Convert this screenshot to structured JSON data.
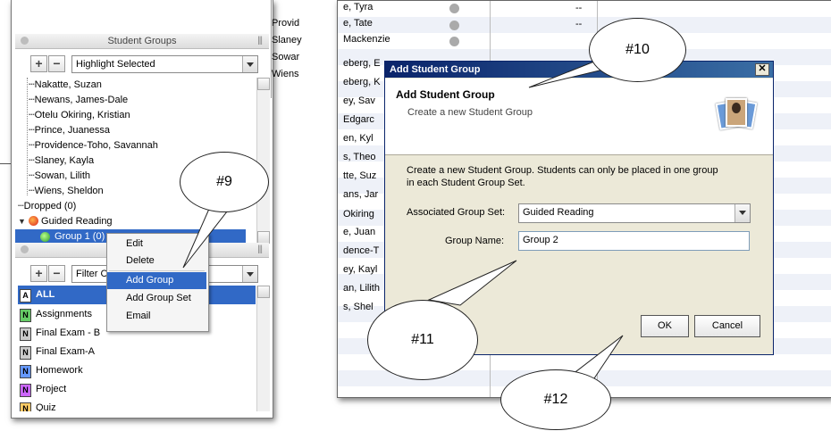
{
  "left_panel": {
    "middle_names": [
      "Provid",
      "Slaney",
      "Sowar",
      "Wiens"
    ],
    "student_groups_header": "Student Groups",
    "highlight_select": "Highlight Selected",
    "tree_items": [
      "Nakatte, Suzan",
      "Newans, James-Dale",
      "Otelu Okiring, Kristian",
      "Prince, Juanessa",
      "Providence-Toho, Savannah",
      "Slaney, Kayla",
      "Sowan, Lilith",
      "Wiens, Sheldon"
    ],
    "dropped": "Dropped (0)",
    "guided_reading": "Guided Reading",
    "group1": "Group 1 (0)",
    "filter_select": "Filter C",
    "categories": [
      {
        "icon": "A",
        "label": "ALL"
      },
      {
        "icon": "N",
        "label": "Assignments"
      },
      {
        "icon": "N",
        "label": "Final Exam - B"
      },
      {
        "icon": "N",
        "label": "Final Exam-A"
      },
      {
        "icon": "N",
        "label": "Homework"
      },
      {
        "icon": "N",
        "label": "Project"
      },
      {
        "icon": "N",
        "label": "Quiz"
      }
    ],
    "context_menu": [
      "Edit",
      "Delete",
      "Add Group",
      "Add Group Set",
      "Email"
    ]
  },
  "callouts": {
    "c9": "#9",
    "c10": "#10",
    "c11": "#11",
    "c12": "#12"
  },
  "right_panel": {
    "names": [
      "e, Tyra",
      "e, Tate",
      "Mackenzie",
      "eberg, E",
      "eberg, K",
      "ey, Sav",
      "Edgarc",
      "en, Kyl",
      "s, Theo",
      "tte, Suz",
      "ans, Jar",
      "Okiring",
      "e, Juan",
      "dence-T",
      "ey, Kayl",
      "an, Lilith",
      "s, Shel"
    ],
    "dashes": "--"
  },
  "dialog": {
    "title_bar": "Add Student Group",
    "heading": "Add Student Group",
    "subheading": "Create a new Student Group",
    "description_line1": "Create a new Student Group. Students can only be placed in one group",
    "description_line2": "in each Student Group Set.",
    "group_set_label": "Associated Group Set:",
    "group_set_value": "Guided Reading",
    "group_name_label": "Group Name:",
    "group_name_value": "Group 2",
    "ok": "OK",
    "cancel": "Cancel"
  }
}
